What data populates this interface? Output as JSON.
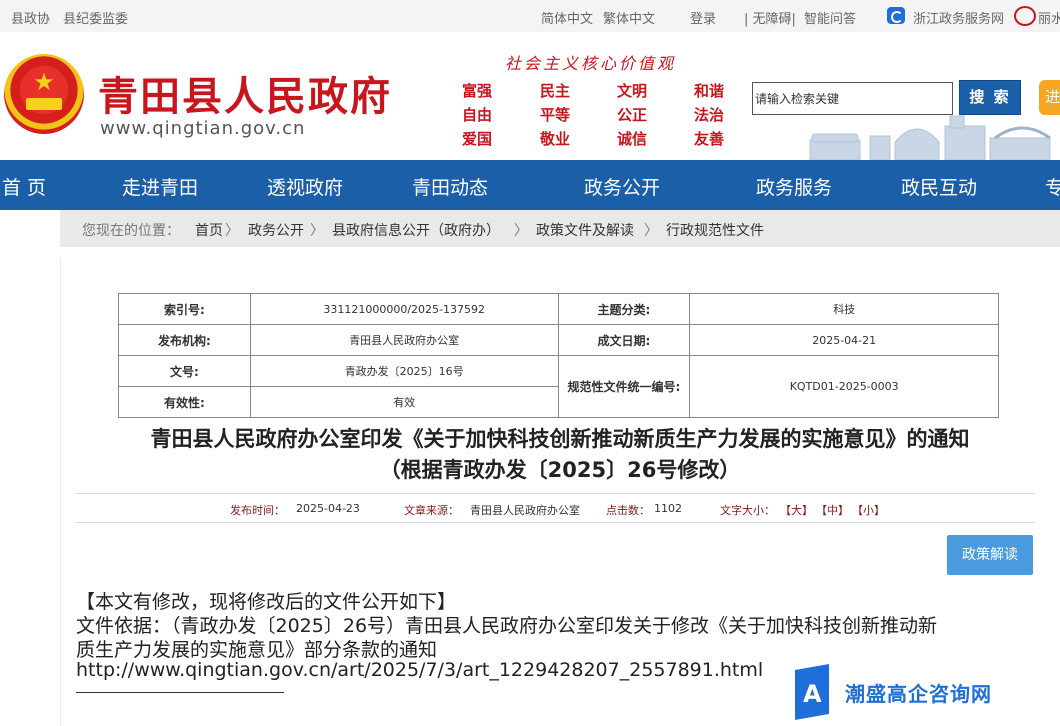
{
  "topbar": {
    "left_links": [
      "县政协",
      "县纪委监委"
    ],
    "lang_simplified": "简体中文",
    "lang_traditional": "繁体中文",
    "login": "登录",
    "accessibility": "| 无障碍|",
    "smart_qa": "智能问答",
    "zj_service": "浙江政务服务网",
    "lishui": "丽水"
  },
  "header": {
    "site_title": "青田县人民政府",
    "site_url": "www.qingtian.gov.cn",
    "values_title": "社会主义核心价值观",
    "values": [
      "富强",
      "民主",
      "文明",
      "和谐",
      "自由",
      "平等",
      "公正",
      "法治",
      "爱国",
      "敬业",
      "诚信",
      "友善"
    ],
    "search_placeholder": "请输入检索关键",
    "search_button": "搜 索",
    "enter_button": "进"
  },
  "nav": {
    "items": [
      "首 页",
      "走进青田",
      "透视政府",
      "青田动态",
      "政务公开",
      "政务服务",
      "政民互动",
      "专"
    ]
  },
  "breadcrumb": {
    "prefix": "您现在的位置：",
    "items": [
      "首页",
      "政务公开",
      "县政府信息公开（政府办）",
      "政策文件及解读",
      "行政规范性文件"
    ],
    "separator": "〉"
  },
  "meta_table": {
    "index_label": "索引号:",
    "index_value": "331121000000/2025-137592",
    "topic_label": "主题分类:",
    "topic_value": "科技",
    "issuer_label": "发布机构:",
    "issuer_value": "青田县人民政府办公室",
    "date_label": "成文日期:",
    "date_value": "2025-04-21",
    "docno_label": "文号:",
    "docno_value": "青政办发〔2025〕16号",
    "uniform_label": "规范性文件统一编号:",
    "uniform_value": "KQTD01-2025-0003",
    "validity_label": "有效性:",
    "validity_value": "有效"
  },
  "document": {
    "title_line1": "青田县人民政府办公室印发《关于加快科技创新推动新质生产力发展的实施意见》的通知",
    "title_line2": "（根据青政办发〔2025〕26号修改）",
    "publish_time_label": "发布时间：",
    "publish_time": "2025-04-23",
    "source_label": "文章来源：",
    "source": "青田县人民政府办公室",
    "clicks_label": "点击数：",
    "clicks": "1102",
    "fontsize_label": "文字大小：",
    "fontsize_large": "【大】",
    "fontsize_medium": "【中】",
    "fontsize_small": "【小】",
    "policy_button": "政策解读",
    "body_lines": [
      "【本文有修改，现将修改后的文件公开如下】",
      "文件依据：（青政办发〔2025〕26号）青田县人民政府办公室印发关于修改《关于加快科技创新推动新",
      "质生产力发展的实施意见》部分条款的通知",
      "http://www.qingtian.gov.cn/art/2025/7/3/art_1229428207_2557891.html"
    ]
  },
  "watermark": {
    "text": "潮盛高企咨询网"
  },
  "colors": {
    "brand_red": "#c8161d",
    "nav_blue": "#1b5fa8",
    "policy_button_blue": "#4b9be0",
    "search_button_blue": "#1b5fa8",
    "enter_orange": "#f5a623"
  }
}
